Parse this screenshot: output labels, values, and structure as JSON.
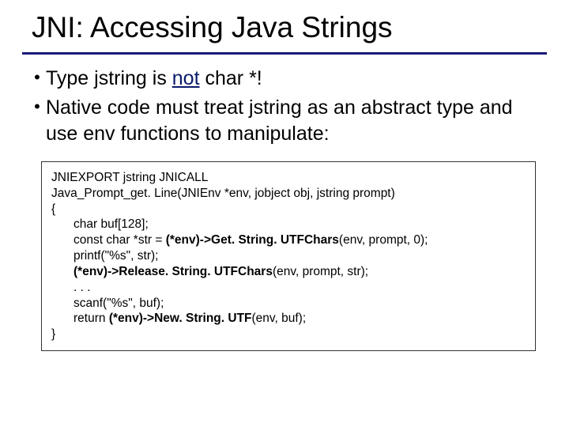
{
  "title": "JNI: Accessing Java Strings",
  "bullets": [
    {
      "pre": "Type jstring is ",
      "em": "not",
      "post": " char *!"
    },
    {
      "pre": "Native code must treat jstring as an abstract type and use env functions to manipulate:",
      "em": "",
      "post": ""
    }
  ],
  "code": {
    "l0": "JNIEXPORT jstring JNICALL",
    "l1": "Java_Prompt_get. Line(JNIEnv *env, jobject obj, jstring prompt)",
    "l2": "{",
    "l3": "char buf[128];",
    "l4a": "const char *str = ",
    "l4b": "(*env)->Get. String. UTFChars",
    "l4c": "(env, prompt, 0);",
    "l5": "printf(\"%s\", str);",
    "l6a": "(*env)->Release. String. UTFChars",
    "l6b": "(env, prompt, str);",
    "l7": ". . .",
    "l8": "scanf(\"%s\", buf);",
    "l9a": "return ",
    "l9b": "(*env)->New. String. UTF",
    "l9c": "(env, buf);",
    "l10": "}"
  }
}
